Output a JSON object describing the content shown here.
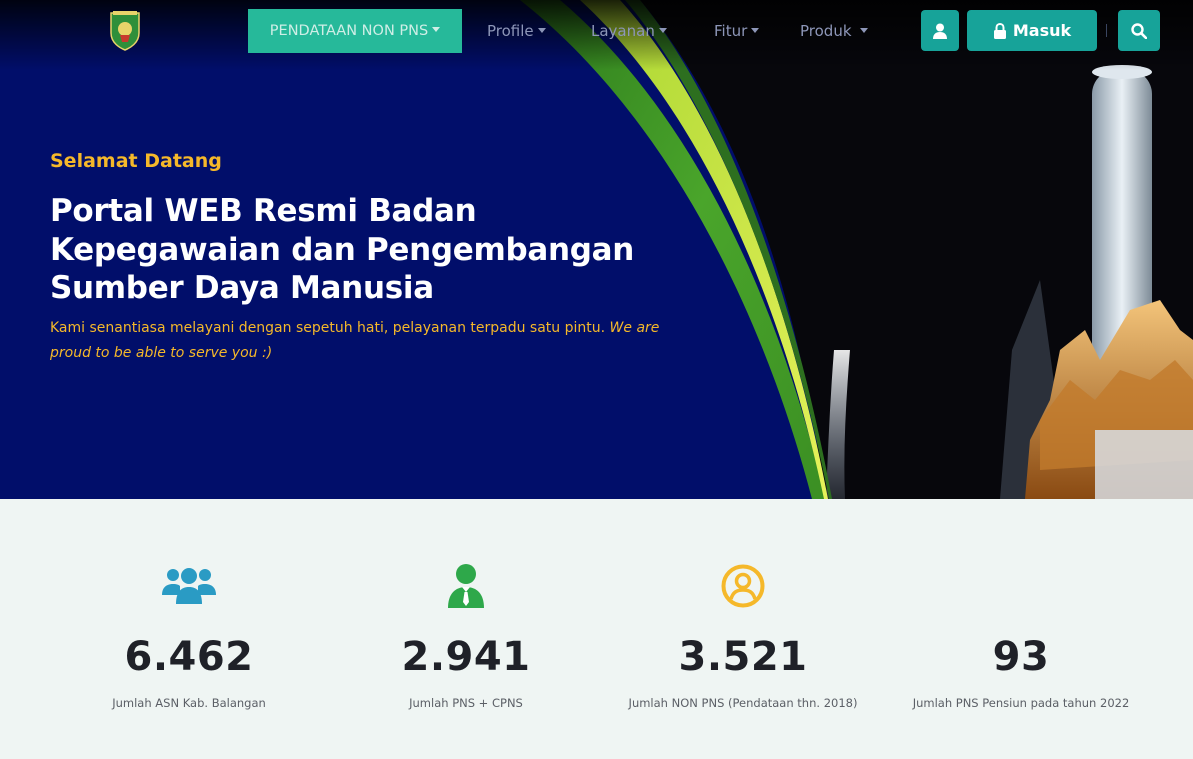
{
  "navbar": {
    "items": [
      {
        "label": "PENDATAAN NON PNS"
      },
      {
        "label": "Profile"
      },
      {
        "label": "Layanan"
      },
      {
        "label": "Fitur"
      },
      {
        "label": "Produk"
      }
    ],
    "login_label": "Masuk"
  },
  "hero": {
    "welcome": "Selamat Datang",
    "headline_lines": [
      "Portal WEB Resmi Badan",
      "Kepegawaian dan Pengembangan",
      "Sumber Daya Manusia"
    ],
    "tagline": "Kami senantiasa melayani dengan sepetuh hati, pelayanan terpadu satu pintu.",
    "tagline_en": "We are proud to be able to serve you :)"
  },
  "stats": [
    {
      "icon": "users-group-icon",
      "color": "#2a9bc4",
      "number": "6.462",
      "label": "Jumlah ASN Kab. Balangan"
    },
    {
      "icon": "user-tie-icon",
      "color": "#2ea84a",
      "number": "2.941",
      "label": "Jumlah PNS + CPNS"
    },
    {
      "icon": "user-circle-icon",
      "color": "#f5b82a",
      "number": "3.521",
      "label": "Jumlah NON PNS (Pendataan thn. 2018)"
    },
    {
      "icon": "",
      "color": "",
      "number": "93",
      "label": "Jumlah PNS Pensiun pada tahun 2022"
    }
  ],
  "colors": {
    "hero_bg": "#010e6a",
    "accent_teal": "#26b99a",
    "accent_yellow": "#f5b82a",
    "stats_bg": "#eff5f3"
  }
}
